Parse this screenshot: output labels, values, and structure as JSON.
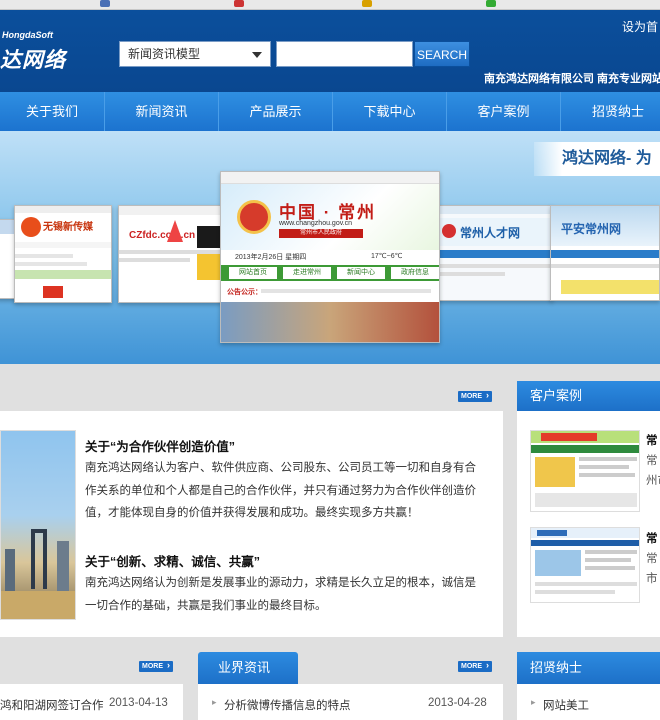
{
  "header": {
    "logo_en": "HongdaSoft",
    "logo_cn": "达网络",
    "set_home": "设为首",
    "company_line": "南充鸿达网络有限公司 南充专业网站"
  },
  "search": {
    "category": "新闻资讯模型",
    "button": "SEARCH"
  },
  "nav": {
    "items": [
      "关于我们",
      "新闻资讯",
      "产品展示",
      "下载中心",
      "客户案例",
      "招贤纳士"
    ]
  },
  "banner": {
    "slogan": "鸿达网络- 为",
    "card1_title": "无锡新传媒",
    "card2_title": "CZfdc.com.cn",
    "card3_title": "中国 · 常州",
    "card3_url": "www.changzhou.gov.cn",
    "card3_sub": "常州市人民政府",
    "card3_date": "2013年2月26日 星期四",
    "card3_weather": "17℃~6℃",
    "card3_nav": [
      "网站首页",
      "走进常州",
      "新闻中心",
      "政府信息"
    ],
    "card3_notice": "公告公示：",
    "card4_title": "常州人才网",
    "card5_title": "平安常州网"
  },
  "about": {
    "more": "MORE",
    "h1": "关于“为合作伙伴创造价值”",
    "p1": "南充鸿达网络认为客户、软件供应商、公司股东、公司员工等一切和自身有合作关系的单位和个人都是自己的合作伙伴，并只有通过努力为合作伙伴创造价值，才能体现自身的价值并获得发展和成功。最终实现多方共赢！",
    "h2": "关于“创新、求精、诚信、共赢”",
    "p2": "南充鸿达网络认为创新是发展事业的源动力，求精是长久立足的根本，诚信是一切合作的基础，共赢是我们事业的最终目标。"
  },
  "cases": {
    "title": "客户案例",
    "items": [
      {
        "name": "常",
        "line2": "常",
        "line3": "州市"
      },
      {
        "name": "常",
        "line2": "常",
        "line3": "市"
      }
    ]
  },
  "news_left": {
    "more": "MORE",
    "item": "鸿和阳湖网签订合作",
    "date": "2013-04-13"
  },
  "industry": {
    "title": "业界资讯",
    "more": "MORE",
    "item": "分析微博传播信息的特点",
    "date": "2013-04-28"
  },
  "jobs": {
    "title": "招贤纳士",
    "item": "网站美工"
  }
}
